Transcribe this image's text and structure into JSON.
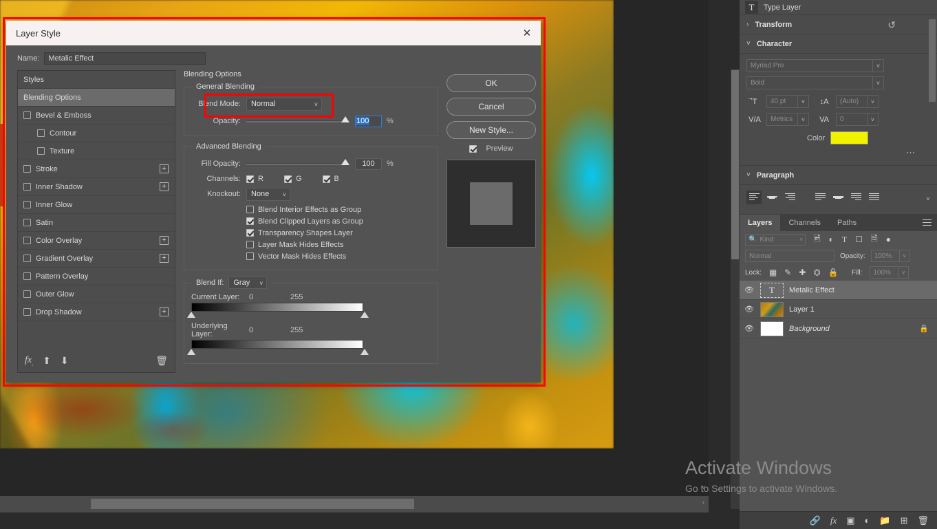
{
  "dialog": {
    "title": "Layer Style",
    "close_icon": "close-icon",
    "name_label": "Name:",
    "name_value": "Metalic Effect",
    "styles_list": [
      {
        "label": "Styles",
        "type": "header",
        "checkbox": false,
        "plus": false,
        "selected": false,
        "indent": false
      },
      {
        "label": "Blending Options",
        "type": "header",
        "checkbox": false,
        "plus": false,
        "selected": true,
        "indent": false
      },
      {
        "label": "Bevel & Emboss",
        "type": "effect",
        "checkbox": true,
        "checked": false,
        "plus": false,
        "selected": false,
        "indent": false
      },
      {
        "label": "Contour",
        "type": "effect",
        "checkbox": true,
        "checked": false,
        "plus": false,
        "selected": false,
        "indent": true
      },
      {
        "label": "Texture",
        "type": "effect",
        "checkbox": true,
        "checked": false,
        "plus": false,
        "selected": false,
        "indent": true
      },
      {
        "label": "Stroke",
        "type": "effect",
        "checkbox": true,
        "checked": false,
        "plus": true,
        "selected": false,
        "indent": false
      },
      {
        "label": "Inner Shadow",
        "type": "effect",
        "checkbox": true,
        "checked": false,
        "plus": true,
        "selected": false,
        "indent": false
      },
      {
        "label": "Inner Glow",
        "type": "effect",
        "checkbox": true,
        "checked": false,
        "plus": false,
        "selected": false,
        "indent": false
      },
      {
        "label": "Satin",
        "type": "effect",
        "checkbox": true,
        "checked": false,
        "plus": false,
        "selected": false,
        "indent": false
      },
      {
        "label": "Color Overlay",
        "type": "effect",
        "checkbox": true,
        "checked": false,
        "plus": true,
        "selected": false,
        "indent": false
      },
      {
        "label": "Gradient Overlay",
        "type": "effect",
        "checkbox": true,
        "checked": false,
        "plus": true,
        "selected": false,
        "indent": false
      },
      {
        "label": "Pattern Overlay",
        "type": "effect",
        "checkbox": true,
        "checked": false,
        "plus": false,
        "selected": false,
        "indent": false
      },
      {
        "label": "Outer Glow",
        "type": "effect",
        "checkbox": true,
        "checked": false,
        "plus": false,
        "selected": false,
        "indent": false
      },
      {
        "label": "Drop Shadow",
        "type": "effect",
        "checkbox": true,
        "checked": false,
        "plus": true,
        "selected": false,
        "indent": false
      }
    ],
    "styles_footer_icons": [
      "fx-icon",
      "move-up-icon",
      "move-down-icon",
      "trash-icon"
    ],
    "blending_options": {
      "title": "Blending Options",
      "general": {
        "legend": "General Blending",
        "blend_mode_label": "Blend Mode:",
        "blend_mode_value": "Normal",
        "opacity_label": "Opacity:",
        "opacity_value": "100",
        "opacity_unit": "%"
      },
      "advanced": {
        "legend": "Advanced Blending",
        "fill_opacity_label": "Fill Opacity:",
        "fill_opacity_value": "100",
        "fill_opacity_unit": "%",
        "channels_label": "Channels:",
        "channels": [
          {
            "label": "R",
            "checked": true
          },
          {
            "label": "G",
            "checked": true
          },
          {
            "label": "B",
            "checked": true
          }
        ],
        "knockout_label": "Knockout:",
        "knockout_value": "None",
        "checkboxes": [
          {
            "label": "Blend Interior Effects as Group",
            "checked": false
          },
          {
            "label": "Blend Clipped Layers as Group",
            "checked": true
          },
          {
            "label": "Transparency Shapes Layer",
            "checked": true
          },
          {
            "label": "Layer Mask Hides Effects",
            "checked": false
          },
          {
            "label": "Vector Mask Hides Effects",
            "checked": false
          }
        ]
      },
      "blend_if": {
        "legend": "Blend If:",
        "channel_value": "Gray",
        "current_layer_label": "Current Layer:",
        "current_min": "0",
        "current_max": "255",
        "underlying_layer_label": "Underlying Layer:",
        "underlying_min": "0",
        "underlying_max": "255"
      }
    },
    "buttons": {
      "ok": "OK",
      "cancel": "Cancel",
      "new_style": "New Style...",
      "preview_label": "Preview",
      "preview_checked": true
    }
  },
  "dock": {
    "type_layer": {
      "icon": "type-layer-icon",
      "label": "Type Layer"
    },
    "transform": {
      "label": "Transform",
      "arrow": "chevron-right-icon",
      "reset_icon": "reset-icon"
    },
    "character": {
      "label": "Character",
      "arrow": "chevron-down-icon",
      "font_family": "Myriad Pro",
      "font_style": "Bold",
      "font_size": "40 pt",
      "leading": "(Auto)",
      "kerning": "Metrics",
      "tracking": "0",
      "color_label": "Color",
      "color_value": "#f2f200",
      "more_icon": "more-options-icon"
    },
    "paragraph": {
      "label": "Paragraph",
      "arrow": "chevron-down-icon",
      "align_buttons": [
        {
          "name": "align-left",
          "active": true
        },
        {
          "name": "align-center",
          "active": false
        },
        {
          "name": "align-right",
          "active": false
        },
        {
          "name": "justify-last-left",
          "active": false
        },
        {
          "name": "justify-last-center",
          "active": false
        },
        {
          "name": "justify-last-right",
          "active": false
        },
        {
          "name": "justify-all",
          "active": false
        }
      ]
    },
    "layers_panel": {
      "tabs": [
        {
          "label": "Layers",
          "active": true
        },
        {
          "label": "Channels",
          "active": false
        },
        {
          "label": "Paths",
          "active": false
        }
      ],
      "menu_icon": "panel-menu-icon",
      "filter_placeholder": "Kind",
      "filter_icons": [
        "pixel-filter-icon",
        "adjustment-filter-icon",
        "type-filter-icon",
        "shape-filter-icon",
        "smart-object-filter-icon",
        "filter-toggle-icon"
      ],
      "blend_mode": "Normal",
      "opacity_label": "Opacity:",
      "opacity_value": "100%",
      "lock_label": "Lock:",
      "lock_icons": [
        "lock-transparent-pixels-icon",
        "lock-image-pixels-icon",
        "lock-position-icon",
        "lock-artboard-icon",
        "lock-all-icon"
      ],
      "fill_label": "Fill:",
      "fill_value": "100%",
      "layers": [
        {
          "name": "Metalic Effect",
          "type": "text",
          "visible": true,
          "selected": true,
          "locked": false,
          "italic": false
        },
        {
          "name": "Layer 1",
          "type": "image",
          "visible": true,
          "selected": false,
          "locked": false,
          "italic": false
        },
        {
          "name": "Background",
          "type": "white",
          "visible": true,
          "selected": false,
          "locked": true,
          "italic": true
        }
      ],
      "bottom_icons": [
        "link-layers-icon",
        "add-layer-style-icon",
        "add-layer-mask-icon",
        "new-adjustment-layer-icon",
        "new-group-icon",
        "new-layer-icon",
        "delete-layer-icon"
      ]
    }
  },
  "watermark": {
    "line1": "Activate Windows",
    "line2": "Go to Settings to activate Windows."
  },
  "colors": {
    "highlight_rect": "#ff0000",
    "selection_blue": "#2a6fc4",
    "text_color_swatch": "#f2f200"
  }
}
